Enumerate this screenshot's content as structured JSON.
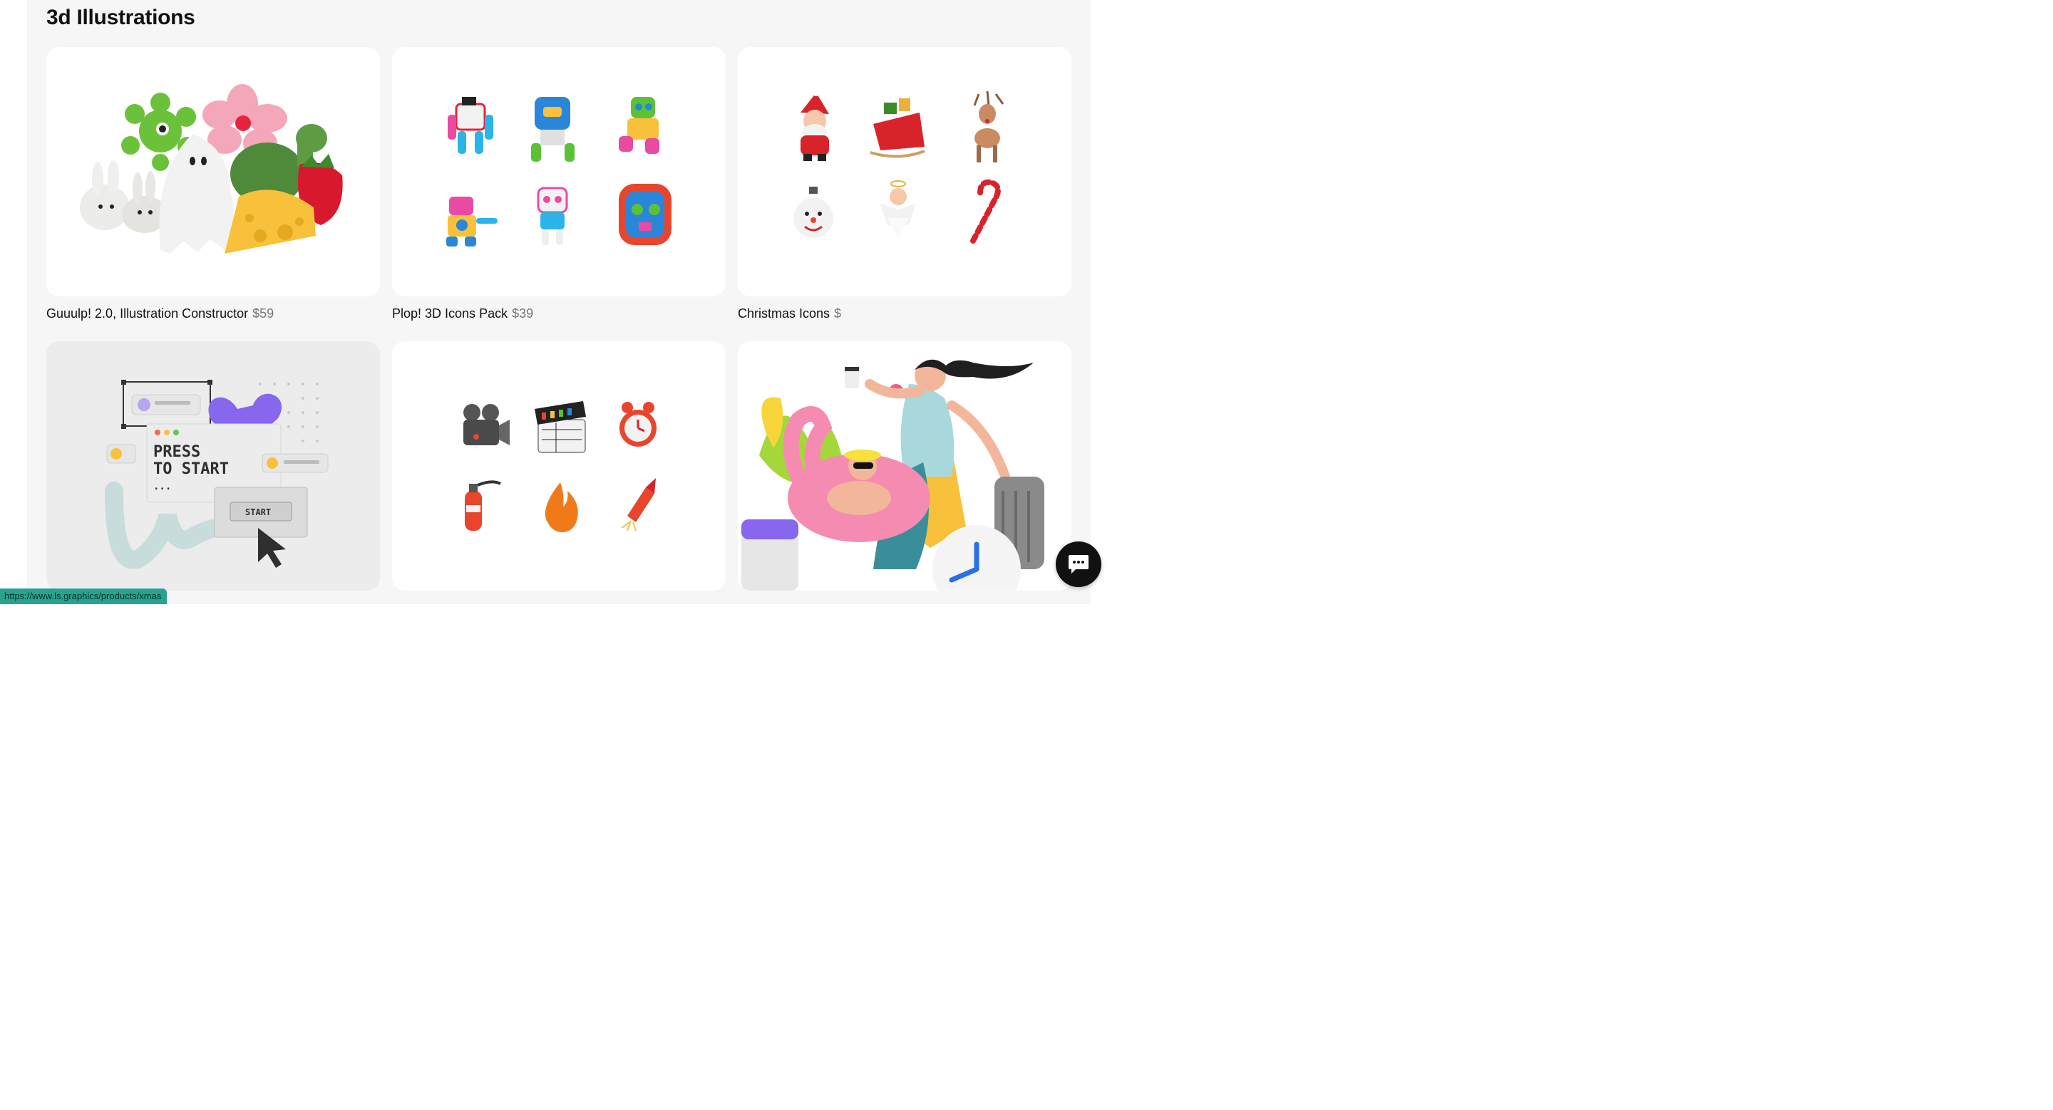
{
  "section": {
    "title": "3d Illustrations"
  },
  "products": [
    {
      "name": "Guuulp! 2.0, Illustration Constructor",
      "price": "$59",
      "image": "guuulp-collage"
    },
    {
      "name": "Plop! 3D Icons Pack",
      "price": "$39",
      "image": "robot-icons"
    },
    {
      "name": "Christmas Icons",
      "price": "$",
      "image": "christmas-icons"
    },
    {
      "name": "",
      "price": "",
      "image": "press-start-illustration",
      "art": {
        "line1": "PRESS",
        "line2": "TO START",
        "dots": "...",
        "button": "START"
      }
    },
    {
      "name": "",
      "price": "",
      "image": "cinema-icons"
    },
    {
      "name": "",
      "price": "",
      "image": "summer-illustration"
    }
  ],
  "status_bar": {
    "url": "https://www.ls.graphics/products/xmas"
  },
  "chat": {
    "icon": "chat-bubble-icon"
  },
  "colors": {
    "background": "#f6f6f6",
    "card": "#ffffff",
    "status": "#27a38f"
  }
}
